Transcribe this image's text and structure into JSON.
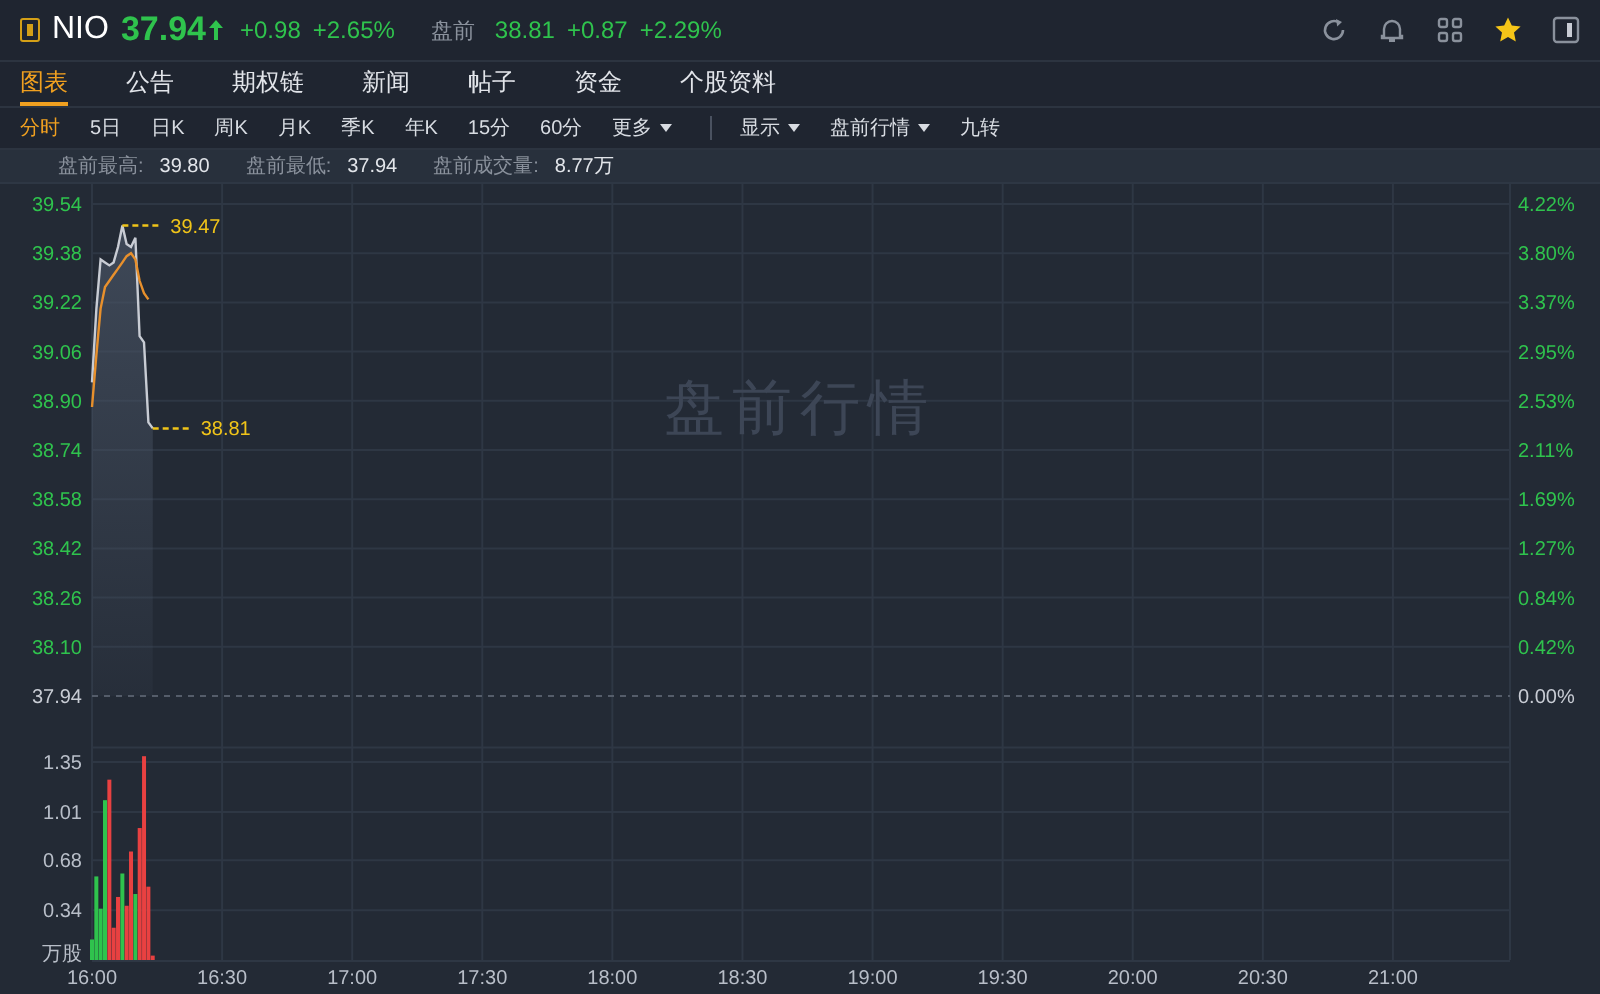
{
  "header": {
    "symbol": "NIO",
    "price": "37.94",
    "rising": true,
    "change": "+0.98",
    "change_pct": "+2.65%",
    "premarket_label": "盘前",
    "premarket_price": "38.81",
    "premarket_change": "+0.87",
    "premarket_change_pct": "+2.29%"
  },
  "toolbar_icons": [
    {
      "kind": "refresh"
    },
    {
      "kind": "bell"
    },
    {
      "kind": "grid"
    },
    {
      "kind": "star"
    },
    {
      "kind": "panel"
    }
  ],
  "tabs": [
    {
      "label": "图表",
      "selected": true
    },
    {
      "label": "公告",
      "selected": false
    },
    {
      "label": "期权链",
      "selected": false
    },
    {
      "label": "新闻",
      "selected": false
    },
    {
      "label": "帖子",
      "selected": false
    },
    {
      "label": "资金",
      "selected": false
    },
    {
      "label": "个股资料",
      "selected": false
    }
  ],
  "periods": [
    {
      "label": "分时",
      "selected": true,
      "dropdown": false
    },
    {
      "label": "5日",
      "selected": false,
      "dropdown": false
    },
    {
      "label": "日K",
      "selected": false,
      "dropdown": false
    },
    {
      "label": "周K",
      "selected": false,
      "dropdown": false
    },
    {
      "label": "月K",
      "selected": false,
      "dropdown": false
    },
    {
      "label": "季K",
      "selected": false,
      "dropdown": false
    },
    {
      "label": "年K",
      "selected": false,
      "dropdown": false
    },
    {
      "label": "15分",
      "selected": false,
      "dropdown": false
    },
    {
      "label": "60分",
      "selected": false,
      "dropdown": false
    },
    {
      "label": "更多",
      "selected": false,
      "dropdown": true
    }
  ],
  "display_options": [
    {
      "label": "显示",
      "dropdown": true
    },
    {
      "label": "盘前行情",
      "dropdown": true
    },
    {
      "label": "九转",
      "dropdown": false
    }
  ],
  "stats": [
    {
      "label": "盘前最高:",
      "value": "39.80"
    },
    {
      "label": "盘前最低:",
      "value": "37.94"
    },
    {
      "label": "盘前成交量:",
      "value": "8.77万"
    }
  ],
  "price_chart": {
    "chart_data": {
      "type": "area",
      "title": "盘前行情",
      "grid": true,
      "x": [
        16,
        16.0167,
        16.0333,
        16.05,
        16.0667,
        16.0833,
        16.1,
        16.1167,
        16.1333,
        16.15,
        16.1667,
        16.1833,
        16.2,
        16.2167,
        16.2333
      ],
      "series": [
        {
          "color": "#c8ccd4",
          "values": [
            38.96,
            39.2,
            39.36,
            39.35,
            39.34,
            39.35,
            39.4,
            39.47,
            39.41,
            39.4,
            39.43,
            39.11,
            39.09,
            38.83,
            38.81
          ]
        },
        {
          "color": "#e8902c",
          "type": "line",
          "values": [
            38.88,
            39.05,
            39.2,
            39.27,
            39.29,
            39.31,
            39.33,
            39.35,
            39.37,
            39.38,
            39.36,
            39.29,
            39.25,
            39.23,
            null
          ]
        }
      ],
      "xlim": [
        16,
        21.45
      ],
      "ylim": [
        37.94,
        39.54
      ],
      "yticks": [
        {
          "value": 39.54,
          "label": "39.54"
        },
        {
          "value": 39.38,
          "label": "39.38"
        },
        {
          "value": 39.22,
          "label": "39.22"
        },
        {
          "value": 39.06,
          "label": "39.06"
        },
        {
          "value": 38.9,
          "label": "38.90"
        },
        {
          "value": 38.74,
          "label": "38.74"
        },
        {
          "value": 38.58,
          "label": "38.58"
        },
        {
          "value": 38.42,
          "label": "38.42"
        },
        {
          "value": 38.26,
          "label": "38.26"
        },
        {
          "value": 38.1,
          "label": "38.10"
        },
        {
          "value": 37.94,
          "label": "37.94"
        }
      ],
      "annotations": [
        {
          "x": 16.1167,
          "y": 39.47,
          "text": "39.47"
        },
        {
          "x": 16.2333,
          "y": 38.81,
          "text": "38.81"
        }
      ]
    },
    "percent_axis": [
      "4.22%",
      "3.80%",
      "3.37%",
      "2.95%",
      "2.53%",
      "2.11%",
      "1.69%",
      "1.27%",
      "0.84%",
      "0.42%",
      "0.00%"
    ]
  },
  "volume_chart": {
    "chart_data": {
      "type": "bar",
      "stacked": true,
      "grid": true,
      "x": [
        16,
        16.0167,
        16.0333,
        16.05,
        16.0667,
        16.0833,
        16.1,
        16.1167,
        16.1333,
        16.15,
        16.1667,
        16.1833,
        16.2,
        16.2167,
        16.2333
      ],
      "series": [
        {
          "color": "#2fc34d",
          "values": [
            0.14,
            0.57,
            0.35,
            1.09,
            null,
            null,
            null,
            0.59,
            null,
            null,
            0.45,
            null,
            null,
            null,
            null
          ]
        },
        {
          "color": "#e84141",
          "values": [
            null,
            null,
            null,
            null,
            1.23,
            0.22,
            0.43,
            null,
            0.37,
            0.74,
            null,
            0.9,
            1.39,
            0.5,
            0.03
          ]
        }
      ],
      "xlim": [
        16,
        21.45
      ],
      "ylim": [
        0,
        1.45
      ],
      "yticks": [
        {
          "value": 1.35,
          "label": "1.35"
        },
        {
          "value": 1.01,
          "label": "1.01"
        },
        {
          "value": 0.68,
          "label": "0.68"
        },
        {
          "value": 0.34,
          "label": "0.34"
        },
        {
          "value": 0,
          "label": "万股"
        }
      ],
      "xticks": [
        {
          "value": 16,
          "label": "16:00"
        },
        {
          "value": 16.5,
          "label": "16:30"
        },
        {
          "value": 17,
          "label": "17:00"
        },
        {
          "value": 17.5,
          "label": "17:30"
        },
        {
          "value": 18,
          "label": "18:00"
        },
        {
          "value": 18.5,
          "label": "18:30"
        },
        {
          "value": 19,
          "label": "19:00"
        },
        {
          "value": 19.5,
          "label": "19:30"
        },
        {
          "value": 20,
          "label": "20:00"
        },
        {
          "value": 20.5,
          "label": "20:30"
        },
        {
          "value": 21,
          "label": "21:00"
        }
      ]
    }
  }
}
